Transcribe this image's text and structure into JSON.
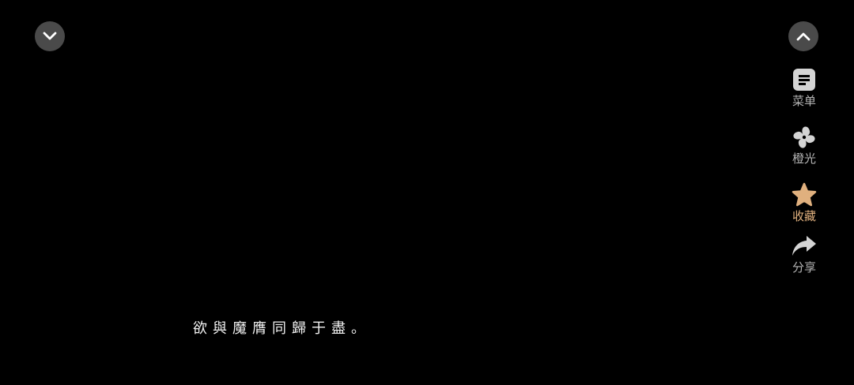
{
  "controls": {
    "collapse_icon": "chevron-down-icon",
    "expand_icon": "chevron-up-icon"
  },
  "side_actions": [
    {
      "id": "menu",
      "label": "菜单",
      "icon": "document-icon",
      "color": "#d4d4d4"
    },
    {
      "id": "orange_light",
      "label": "橙光",
      "icon": "pinwheel-icon",
      "color": "#d4d4d4"
    },
    {
      "id": "favorite",
      "label": "收藏",
      "icon": "star-icon",
      "color": "#e0b07e"
    },
    {
      "id": "share",
      "label": "分享",
      "icon": "share-arrow-icon",
      "color": "#d4d4d4"
    }
  ],
  "dialogue": {
    "text": "欲與魔膺同歸于盡。"
  },
  "colors": {
    "background": "#000000",
    "button_bg": "#4a4a4a",
    "label": "#b4b4b4",
    "accent": "#e0b07e",
    "subtitle": "#f2f2f2"
  }
}
